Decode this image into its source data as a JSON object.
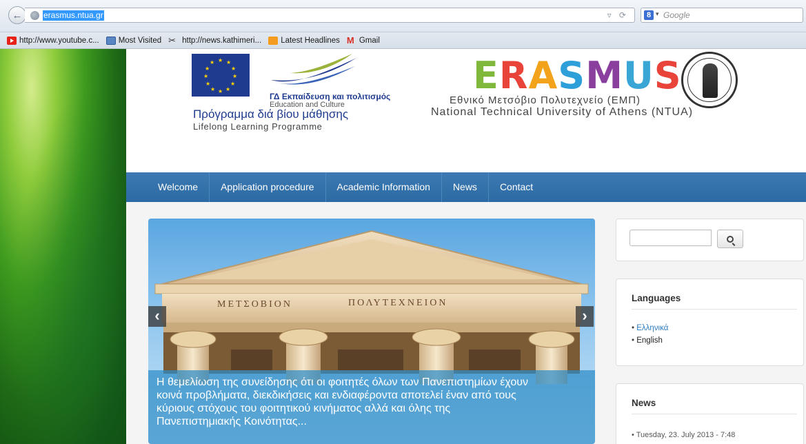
{
  "browser": {
    "url": "erasmus.ntua.gr",
    "search_placeholder": "Google",
    "bookmarks": [
      {
        "label": "http://www.youtube.c...",
        "icon": "youtube-icon"
      },
      {
        "label": "Most Visited",
        "icon": "most-visited-icon"
      },
      {
        "label": "http://news.kathimeri...",
        "icon": "kathimerini-icon"
      },
      {
        "label": "Latest Headlines",
        "icon": "rss-icon"
      },
      {
        "label": "Gmail",
        "icon": "gmail-icon"
      }
    ]
  },
  "header": {
    "eu_line1": "ΓΔ Εκπαίδευση και πολιτισμός",
    "eu_line2": "Education and Culture",
    "llp_greek": "Πρόγραμμα διά βίου μάθησης",
    "llp_english": "Lifelong Learning Programme",
    "erasmus_logo": "ERASMUS",
    "ntua_greek": "Εθνικό Μετσόβιο Πολυτεχνείο (ΕΜΠ)",
    "ntua_english": "National Technical University of Athens (NTUA)"
  },
  "nav": {
    "items": [
      "Welcome",
      "Application procedure",
      "Academic Information",
      "News",
      "Contact"
    ]
  },
  "slider": {
    "inscription_left": "ΜΕΤΣΟΒΙΟΝ",
    "inscription_right": "ΠΟΛΥΤΕΧΝΕΙΟΝ",
    "caption_lines": [
      "Η θεμελίωση της συνείδησης ότι οι φοιτητές όλων των Πανεπιστημίων έχουν",
      "κοινά προβλήματα, διεκδικήσεις και ενδιαφέροντα αποτελεί έναν από τους",
      "κύριους στόχους του φοιτητικού κινήματος αλλά και όλης της",
      "Πανεπιστημιακής Κοινότητας..."
    ]
  },
  "sidebar": {
    "languages_title": "Languages",
    "languages": [
      "Ελληνικά",
      "English"
    ],
    "news_title": "News",
    "news_items": [
      "Tuesday, 23. July 2013 - 7:48"
    ]
  },
  "colors": {
    "nav_bg": "#2f6fa8",
    "erasmus_letters": [
      "#7fb83a",
      "#e8443a",
      "#f3a31b",
      "#2e9fd9",
      "#8a3e9d",
      "#39a6d6",
      "#e8443a"
    ]
  }
}
